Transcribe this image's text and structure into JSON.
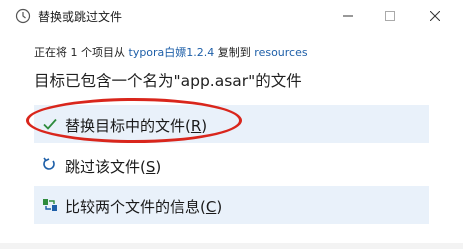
{
  "window": {
    "title": "替换或跳过文件",
    "minimize_glyph": "—",
    "maximize_glyph": "☐",
    "close_glyph": "✕"
  },
  "info": {
    "prefix": "正在将 1 个项目从 ",
    "source": "typora白嫖1.2.4",
    "middle": " 复制到 ",
    "destination": "resources"
  },
  "heading": "目标已包含一个名为\"app.asar\"的文件",
  "options": [
    {
      "label_main": "替换目标中的文件(",
      "hotkey": "R",
      "label_end": ")",
      "icon": "checkmark-icon"
    },
    {
      "label_main": "跳过该文件(",
      "hotkey": "S",
      "label_end": ")",
      "icon": "skip-arrow-icon"
    },
    {
      "label_main": "比较两个文件的信息(",
      "hotkey": "C",
      "label_end": ")",
      "icon": "compare-icon"
    }
  ],
  "colors": {
    "accent": "#1e5fa8",
    "option_bg": "#e9f1fa",
    "annotation": "#d9261c"
  }
}
